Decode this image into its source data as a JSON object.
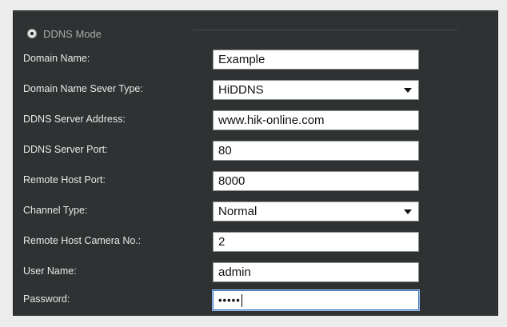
{
  "section": {
    "mode_label": "DDNS Mode"
  },
  "fields": [
    {
      "label": "Domain Name:",
      "value": "Example",
      "type": "text"
    },
    {
      "label": "Domain Name Sever Type:",
      "value": "HiDDNS",
      "type": "select"
    },
    {
      "label": "DDNS Server Address:",
      "value": "www.hik-online.com",
      "type": "text"
    },
    {
      "label": "DDNS Server Port:",
      "value": "80",
      "type": "text"
    },
    {
      "label": "Remote Host Port:",
      "value": "8000",
      "type": "text"
    },
    {
      "label": "Channel Type:",
      "value": "Normal",
      "type": "select"
    },
    {
      "label": "Remote Host Camera No.:",
      "value": "2",
      "type": "text"
    },
    {
      "label": "User Name:",
      "value": "admin",
      "type": "text"
    },
    {
      "label": "Password:",
      "value": "•••••",
      "type": "password"
    }
  ],
  "colors": {
    "panel_bg": "#2e3233",
    "label_text": "#e9e9e9",
    "mode_text": "#a9a9a9",
    "field_bg": "#ffffff"
  }
}
